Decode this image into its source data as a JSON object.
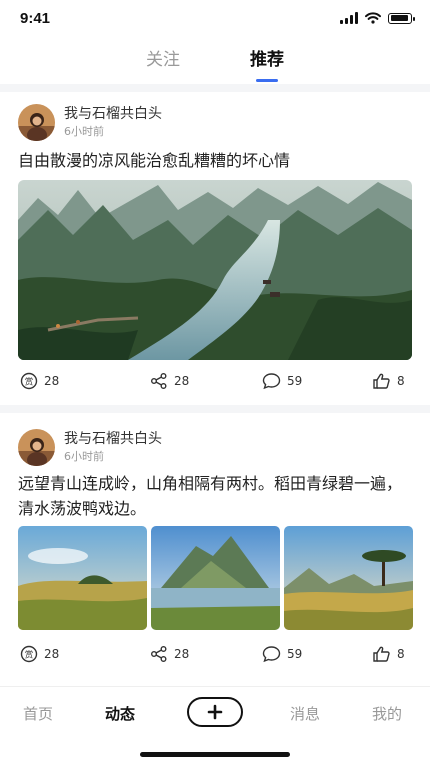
{
  "status": {
    "time": "9:41"
  },
  "tabs": [
    {
      "label": "关注",
      "active": false
    },
    {
      "label": "推荐",
      "active": true
    }
  ],
  "accent_color": "#3a6df0",
  "posts": [
    {
      "author": "我与石榴共白头",
      "time": "6小时前",
      "text": "自由散漫的凉风能治愈乱糟糟的坏心情",
      "images": [
        "river-valley-karst-landscape"
      ],
      "actions": {
        "reward": "28",
        "share": "28",
        "comment": "59",
        "like": "8"
      }
    },
    {
      "author": "我与石榴共白头",
      "time": "6小时前",
      "text": "远望青山连成岭，山角相隔有两村。稻田青绿碧一遍，清水荡波鸭戏边。",
      "images": [
        "grassland-sunset",
        "mountain-lake",
        "savanna-tree"
      ],
      "actions": {
        "reward": "28",
        "share": "28",
        "comment": "59",
        "like": "8"
      }
    }
  ],
  "bottom_nav": [
    {
      "label": "首页",
      "active": false
    },
    {
      "label": "动态",
      "active": true
    },
    {
      "label": "消息",
      "active": false
    },
    {
      "label": "我的",
      "active": false
    }
  ]
}
